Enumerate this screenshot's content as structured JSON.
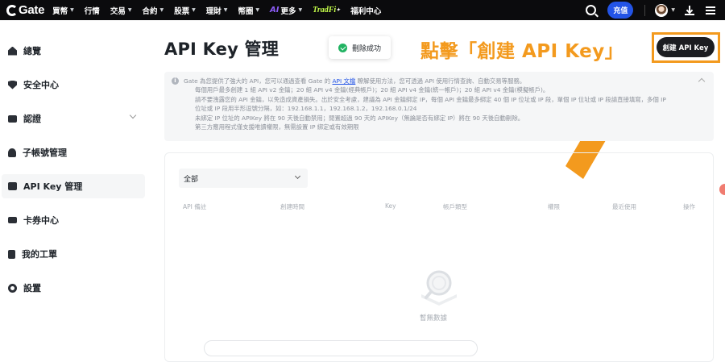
{
  "nav": {
    "logo": "Gate",
    "items": [
      {
        "label": "買幣",
        "dropdown": true
      },
      {
        "label": "行情",
        "dropdown": false
      },
      {
        "label": "交易",
        "dropdown": true
      },
      {
        "label": "合約",
        "dropdown": true
      },
      {
        "label": "股票",
        "dropdown": true
      },
      {
        "label": "理財",
        "dropdown": true
      },
      {
        "label": "幣圈",
        "dropdown": true
      },
      {
        "label": "更多",
        "dropdown": true
      },
      {
        "label": "TradFi",
        "dropdown": false
      },
      {
        "label": "福利中心",
        "dropdown": false
      }
    ],
    "ai_badge": "AI",
    "deposit": "充值",
    "icons": [
      "search-icon",
      "avatar",
      "download-icon",
      "menu-icon"
    ]
  },
  "sidebar": {
    "items": [
      {
        "label": "總覽",
        "icon": "home-icon",
        "active": false
      },
      {
        "label": "安全中心",
        "icon": "shield-icon",
        "active": false
      },
      {
        "label": "認證",
        "icon": "id-card-icon",
        "active": false,
        "expandable": true
      },
      {
        "label": "子帳號管理",
        "icon": "sub-account-icon",
        "active": false
      },
      {
        "label": "API Key 管理",
        "icon": "api-key-icon",
        "active": true
      },
      {
        "label": "卡券中心",
        "icon": "coupon-icon",
        "active": false
      },
      {
        "label": "我的工單",
        "icon": "ticket-icon",
        "active": false
      },
      {
        "label": "設置",
        "icon": "settings-icon",
        "active": false
      }
    ]
  },
  "main": {
    "title": "API Key 管理",
    "toast": "刪除成功",
    "annotation": "點擊「創建 API Key」",
    "create_button": "創建 API Key",
    "notice": {
      "intro_before": "Gate 為您提供了強大的 API，您可以通過查看 Gate 的",
      "intro_link": "API 文檔",
      "intro_after": "瞭解使用方法，您可透過 API 使用行情查詢、自動交易等服務。",
      "lines": [
        "每個用戶最多創建 1 組 API v2 金鑰；20 組 API v4 金鑰(經典帳戶)；20 組 API v4 金鑰(統一帳戶)；20 組 API v4 金鑰(模擬帳戶)。",
        "請不要洩露您的 API 金鑰，以免造成資產損失。出於安全考慮，建議為 API 金鑰綁定 IP，每個 API 金鑰最多綁定 40 個 IP 位址或 IP 段，單個 IP 位址或 IP 段請直接填寫，多個 IP",
        "位址或 IP 段用半形逗號分隔，如：192.168.1.1，192.168.1.2，192.168.0.1/24",
        "未綁定 IP 位址的 APIKey 將在 90 天後自動禁用；閒置超過 90 天的 APIKey（無論是否有綁定 IP）將在 90 天後自動刪除。",
        "第三方應用程式僅支援唯讀權限，無需設置 IP 綁定或有效期限"
      ]
    },
    "filter": "全部",
    "columns": [
      "API 備註",
      "創建時間",
      "Key",
      "帳戶類型",
      "權限",
      "最近使用",
      "操作"
    ],
    "empty_text": "暫無數據"
  },
  "colors": {
    "accent_orange": "#f39a1e",
    "brand_blue": "#2354e6",
    "success_green": "#21b362",
    "nav_bg": "#0b0b0d"
  }
}
